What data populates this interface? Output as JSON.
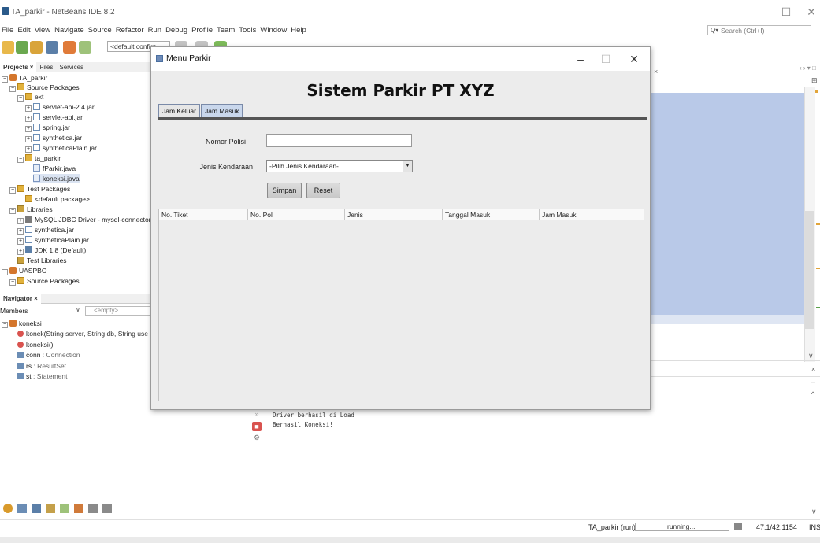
{
  "window": {
    "title": "TA_parkir - NetBeans IDE 8.2",
    "controls": {
      "minimize": "–",
      "maximize": "☐",
      "close": "✕"
    }
  },
  "menubar": [
    "File",
    "Edit",
    "View",
    "Navigate",
    "Source",
    "Refactor",
    "Run",
    "Debug",
    "Profile",
    "Team",
    "Tools",
    "Window",
    "Help"
  ],
  "search": {
    "placeholder": "Search (Ctrl+I)"
  },
  "toolbar": {
    "config": "<default config>"
  },
  "projects_panel": {
    "tabs": [
      "Projects ×",
      "Files",
      "Services"
    ],
    "tree": [
      {
        "label": "TA_parkir",
        "icon": "project-icon"
      },
      {
        "label": "Source Packages",
        "icon": "package-folder-icon"
      },
      {
        "label": "ext",
        "icon": "package-icon"
      },
      {
        "label": "servlet-api-2.4.jar",
        "icon": "jar-icon"
      },
      {
        "label": "servlet-api.jar",
        "icon": "jar-icon"
      },
      {
        "label": "spring.jar",
        "icon": "jar-icon"
      },
      {
        "label": "synthetica.jar",
        "icon": "jar-icon"
      },
      {
        "label": "syntheticaPlain.jar",
        "icon": "jar-icon"
      },
      {
        "label": "ta_parkir",
        "icon": "package-icon"
      },
      {
        "label": "fParkir.java",
        "icon": "java-file-icon"
      },
      {
        "label": "koneksi.java",
        "icon": "java-file-icon"
      },
      {
        "label": "Test Packages",
        "icon": "package-folder-icon"
      },
      {
        "label": "<default package>",
        "icon": "package-icon"
      },
      {
        "label": "Libraries",
        "icon": "library-icon"
      },
      {
        "label": "MySQL JDBC Driver - mysql-connector-",
        "icon": "database-icon"
      },
      {
        "label": "synthetica.jar",
        "icon": "jar-icon"
      },
      {
        "label": "syntheticaPlain.jar",
        "icon": "jar-icon"
      },
      {
        "label": "JDK 1.8 (Default)",
        "icon": "jdk-icon"
      },
      {
        "label": "Test Libraries",
        "icon": "library-icon"
      },
      {
        "label": "UASPBO",
        "icon": "project-icon"
      },
      {
        "label": "Source Packages",
        "icon": "package-folder-icon"
      }
    ]
  },
  "navigator_panel": {
    "tab": "Navigator ×",
    "members_label": "Members",
    "filter_placeholder": "<empty>",
    "class_name": "koneksi",
    "members": [
      {
        "name": "konek(",
        "sig": "String server, String db, String use",
        "kind": "method"
      },
      {
        "name": "koneksi()",
        "sig": "",
        "kind": "method"
      },
      {
        "name": "conn",
        "sig": " : Connection",
        "kind": "field"
      },
      {
        "name": "rs",
        "sig": " : ResultSet",
        "kind": "field"
      },
      {
        "name": "st",
        "sig": " : Statement",
        "kind": "field"
      }
    ]
  },
  "output": {
    "lines": [
      "Driver berhasil di Load",
      "Berhasil Koneksi!"
    ]
  },
  "statusbar": {
    "project_run": "TA_parkir (run)",
    "progress_text": "running...",
    "position": "47:1/42:1154",
    "mode": "INS"
  },
  "dialog": {
    "title": "Menu Parkir",
    "controls": {
      "minimize": "–",
      "maximize": "☐",
      "close": "✕"
    },
    "heading": "Sistem Parkir PT XYZ",
    "tabs": [
      "Jam Keluar",
      "Jam Masuk"
    ],
    "active_tab": "Jam Masuk",
    "form": {
      "nopol_label": "Nomor Polisi",
      "nopol_value": "",
      "jenis_label": "Jenis Kendaraan",
      "jenis_selected": "-Pilih Jenis Kendaraan-",
      "save_label": "Simpan",
      "reset_label": "Reset"
    },
    "table": {
      "columns": [
        "No. Tiket",
        "No. Pol",
        "Jenis",
        "Tanggal Masuk",
        "Jam Masuk"
      ],
      "rows": []
    }
  },
  "colors": {
    "editor_selection": "#b9c9e8",
    "tab_active": "#c9d7ec",
    "dialog_bg": "#ececec"
  }
}
